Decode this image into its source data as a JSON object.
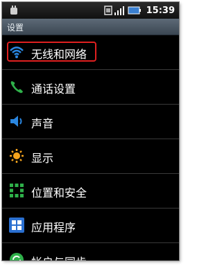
{
  "status_bar": {
    "time": "15:39",
    "icons": [
      "usb-icon",
      "sim-icon",
      "signal-icon",
      "battery-icon"
    ]
  },
  "title_bar": {
    "title": "设置"
  },
  "settings": {
    "items": [
      {
        "label": "无线和网络",
        "icon": "wifi-icon",
        "highlighted": true
      },
      {
        "label": "通话设置",
        "icon": "phone-icon"
      },
      {
        "label": "声音",
        "icon": "speaker-icon"
      },
      {
        "label": "显示",
        "icon": "brightness-icon"
      },
      {
        "label": "位置和安全",
        "icon": "location-grid-icon"
      },
      {
        "label": "应用程序",
        "icon": "apps-icon"
      },
      {
        "label": "帐户与同步",
        "icon": "sync-icon"
      }
    ]
  },
  "colors": {
    "highlight_border": "#e02020",
    "title_bar": "#4b5764"
  }
}
